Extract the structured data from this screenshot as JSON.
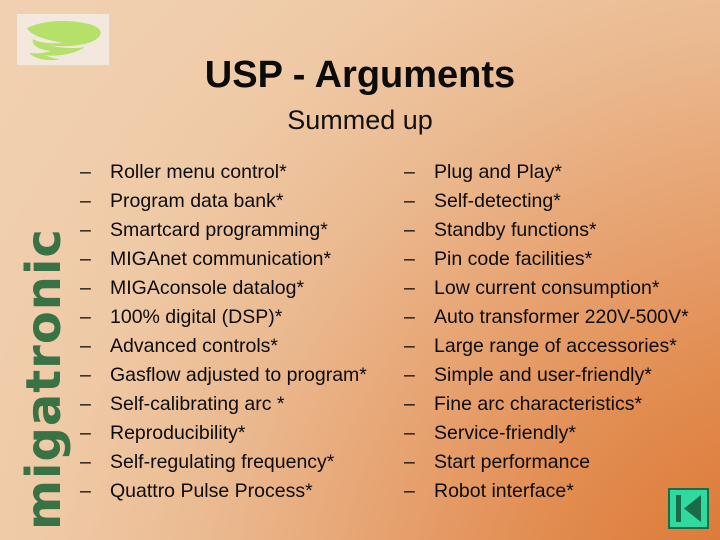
{
  "slide": {
    "title": "USP - Arguments",
    "subtitle": "Summed up",
    "bullet_marker": "–",
    "brand_wordmark": "migatronic",
    "colors": {
      "background_top": "#f0d0b0",
      "background_bottom_right": "#d9732f",
      "title_text": "#0b0b0b",
      "brand_green": "#2a6b3c",
      "logo_green": "#b5e06a",
      "logo_box": "#f2e8dd",
      "nav_button_fill": "#2fd9a0",
      "nav_button_border": "#1b6b4a"
    }
  },
  "logo": {
    "name": "migatronic-swoosh-logo",
    "icon": "swoosh-icon"
  },
  "columns": {
    "left": [
      "Roller menu control*",
      "Program data bank*",
      "Smartcard programming*",
      "MIGAnet communication*",
      "MIGAconsole datalog*",
      "100% digital (DSP)*",
      "Advanced controls*",
      "Gasflow adjusted to program*",
      "Self-calibrating arc *",
      "Reproducibility*",
      "Self-regulating frequency*",
      "Quattro Pulse Process*"
    ],
    "right": [
      "Plug and Play*",
      "Self-detecting*",
      "Standby functions*",
      "Pin code facilities*",
      "Low current consumption*",
      "Auto transformer 220V-500V*",
      "Large range of accessories*",
      "Simple and user-friendly*",
      "Fine arc characteristics*",
      "Service-friendly*",
      "Start performance",
      "Robot interface*"
    ]
  },
  "nav": {
    "previous_button_label": "Previous slide",
    "icon": "skip-to-start-icon"
  }
}
